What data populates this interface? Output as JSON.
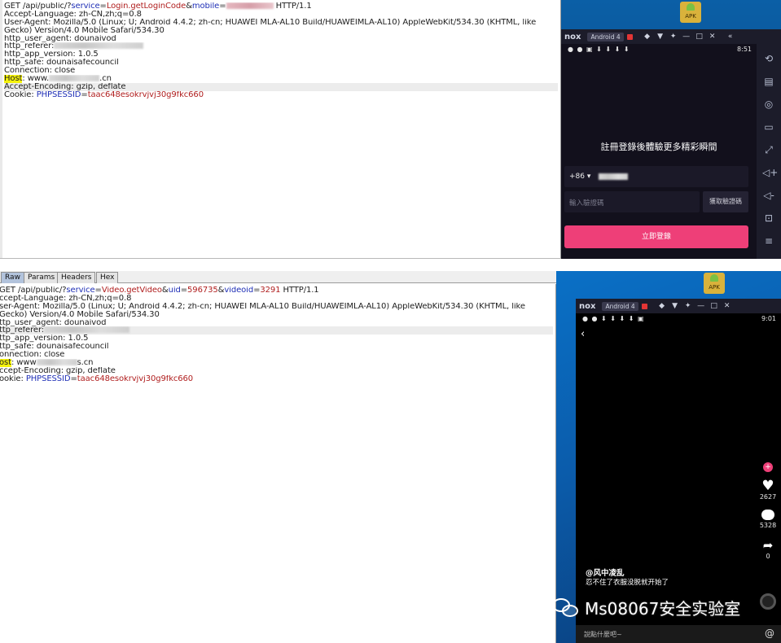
{
  "top_request": {
    "l1_prefix": "GET /api/public/?",
    "l1_k1": "service",
    "l1_eq": "=",
    "l1_v1": "Login.getLoginCode",
    "l1_amp": "&",
    "l1_k2": "mobile",
    "l1_eq2": "=",
    "l1_suffix": " HTTP/1.1",
    "l2": "Accept-Language: zh-CN,zh;q=0.8",
    "l3": "User-Agent: Mozilla/5.0 (Linux; U; Android 4.4.2; zh-cn; HUAWEI MLA-AL10 Build/HUAWEIMLA-AL10) AppleWebKit/534.30 (KHTML, like Gecko) Version/4.0 Mobile Safari/534.30",
    "l4": "http_user_agent: dounaivod",
    "l5": "http_referer:",
    "l6": "http_app_version: 1.0.5",
    "l7": "http_safe: dounaisafecouncil",
    "l8": "Connection: close",
    "l9_key": "Host",
    "l9_rest": ": www.",
    "l9_tld": ".cn",
    "l10": "Accept-Encoding: gzip, deflate",
    "l11_key": "Cookie: ",
    "l11_name": "PHPSESSID",
    "l11_eq": "=",
    "l11_val": "taac648esokrvjvj30g9fkc660"
  },
  "tabs": [
    "Raw",
    "Params",
    "Headers",
    "Hex"
  ],
  "bottom_request": {
    "l1_prefix": "GET /api/public/?",
    "l1_k1": "service",
    "l1_eq": "=",
    "l1_v1": "Video.getVideo",
    "l1_amp": "&",
    "l1_k2": "uid",
    "l1_eq2": "=",
    "l1_v2": "596735",
    "l1_amp2": "&",
    "l1_k3": "videoid",
    "l1_eq3": "=",
    "l1_v3": "3291",
    "l1_suffix": " HTTP/1.1",
    "l2": "ccept-Language: zh-CN,zh;q=0.8",
    "l3": "ser-Agent: Mozilla/5.0 (Linux; U; Android 4.4.2; zh-cn; HUAWEI MLA-AL10 Build/HUAWEIMLA-AL10) AppleWebKit/534.30 (KHTML, like Gecko) Version/4.0 Mobile Safari/534.30",
    "l4": "ttp_user_agent: dounaivod",
    "l5": "ttp_referer:",
    "l6": "ttp_app_version: 1.0.5",
    "l7": "ttp_safe: dounaisafecouncil",
    "l8": "onnection: close",
    "l9_key": "ost",
    "l9_rest": ": www",
    "l9_tld": "s.cn",
    "l10": "ccept-Encoding: gzip, deflate",
    "l11_key": "ookie: ",
    "l11_name": "PHPSESSID",
    "l11_eq": "=",
    "l11_val": "taac648esokrvjvj30g9fkc660"
  },
  "emulator": {
    "apk_label": "APK",
    "nox_logo": "nox",
    "android_badge": "Android 4",
    "controls": [
      "◆",
      "▼",
      "✦",
      "—",
      "□",
      "✕",
      "«"
    ],
    "bottom_controls": [
      "◆",
      "▼",
      "✦",
      "—",
      "□",
      "✕"
    ]
  },
  "login_screen": {
    "status_time": "8:51",
    "title": "註冊登錄後體驗更多精彩瞬間",
    "country_code": "+86 ▾",
    "code_placeholder": "輸入驗證碼",
    "get_code_button": "獲取驗證碼",
    "login_button": "立即登錄"
  },
  "video_screen": {
    "status_time": "9:01",
    "likes": "2627",
    "comments": "5328",
    "shares": "0",
    "author": "@风中凌乱",
    "caption": "忍不住了衣服没脱就开始了",
    "comment_placeholder": "說點什麼吧~",
    "at_symbol": "@"
  },
  "watermark": {
    "text": "Ms08067安全实验室"
  }
}
